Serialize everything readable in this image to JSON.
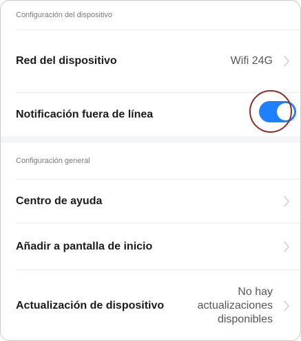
{
  "sections": [
    {
      "header": "Configuración del dispositivo",
      "rows": [
        {
          "label": "Red del dispositivo",
          "value": "Wifi 24G",
          "chevron": true
        },
        {
          "label": "Notificación fuera de línea",
          "toggle": true,
          "toggle_on": true
        }
      ]
    },
    {
      "header": "Configuración general",
      "rows": [
        {
          "label": "Centro de ayuda",
          "chevron": true
        },
        {
          "label": "Añadir a pantalla de inicio",
          "chevron": true
        },
        {
          "label": "Actualización de dispositivo",
          "value_lines": [
            "No hay",
            "actualizaciones",
            "disponibles"
          ],
          "chevron": true
        }
      ]
    }
  ],
  "colors": {
    "toggle_on": "#1e80ff",
    "highlight_ring": "#8f2a24",
    "section_gap": "#f4f5f7"
  },
  "icons": [
    "chevron-right-icon"
  ]
}
